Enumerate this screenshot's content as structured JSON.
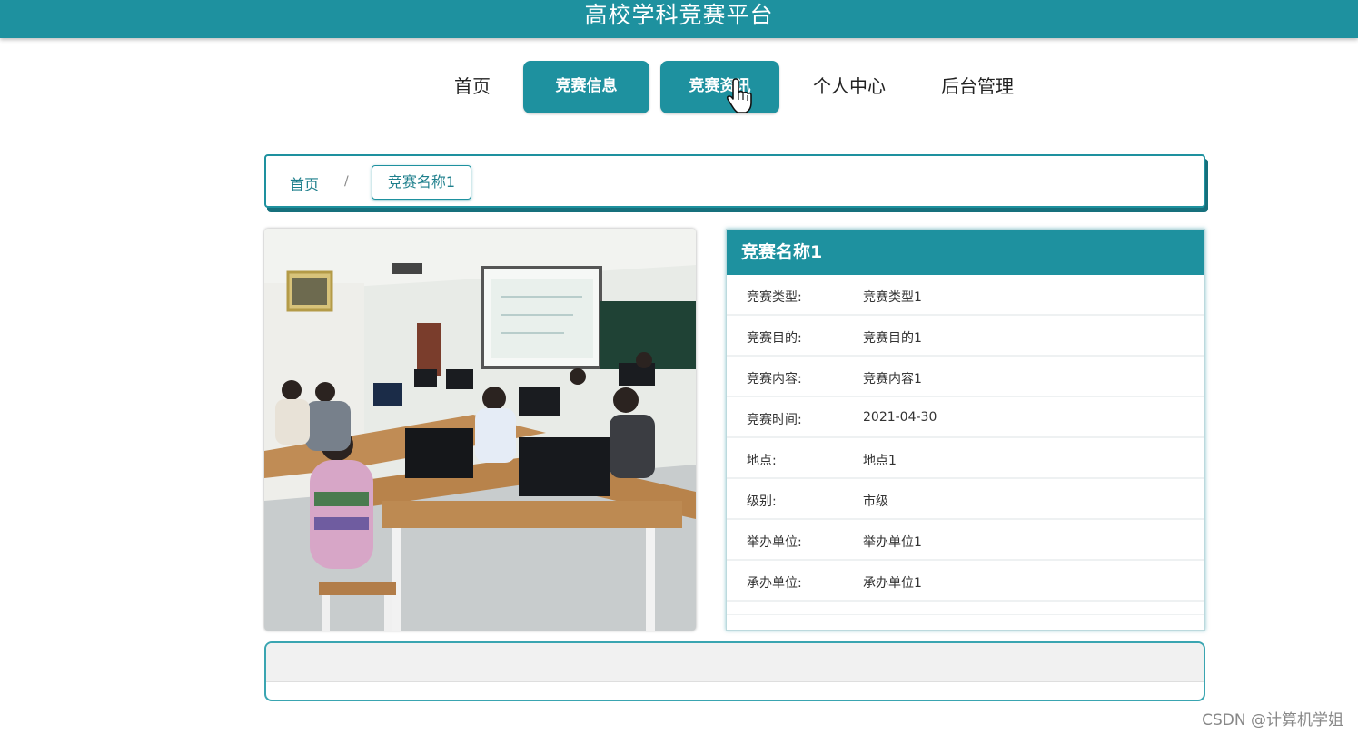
{
  "header": {
    "title": "高校学科竞赛平台"
  },
  "nav": {
    "items": [
      {
        "label": "首页"
      },
      {
        "label": "竞赛信息"
      },
      {
        "label": "竞赛资讯"
      },
      {
        "label": "个人中心"
      },
      {
        "label": "后台管理"
      }
    ],
    "active": [
      "竞赛信息",
      "竞赛资讯"
    ]
  },
  "breadcrumb": {
    "home": "首页",
    "separator": "/",
    "current": "竞赛名称1"
  },
  "detail": {
    "title": "竞赛名称1",
    "rows": [
      {
        "key": "竞赛类型:",
        "value": "竞赛类型1"
      },
      {
        "key": "竞赛目的:",
        "value": "竞赛目的1"
      },
      {
        "key": "竞赛内容:",
        "value": "竞赛内容1"
      },
      {
        "key": "竞赛时间:",
        "value": "2021-04-30"
      },
      {
        "key": "地点:",
        "value": "地点1"
      },
      {
        "key": "级别:",
        "value": "市级"
      },
      {
        "key": "举办单位:",
        "value": "举办单位1"
      },
      {
        "key": "承办单位:",
        "value": "承办单位1"
      }
    ]
  },
  "watermark": "CSDN @计算机学姐",
  "colors": {
    "accent": "#1e919f",
    "accent_dark": "#16707c"
  },
  "icons": {
    "cursor": "hand-pointer-icon"
  }
}
